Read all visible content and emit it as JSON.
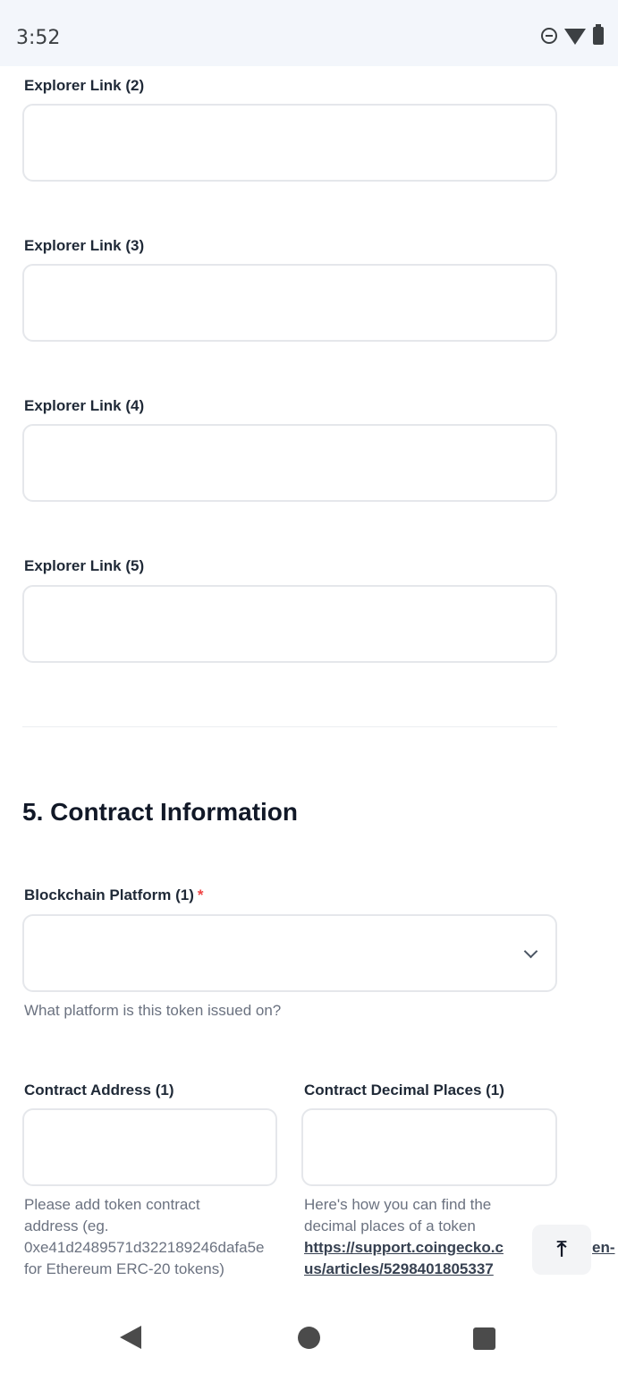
{
  "status_bar": {
    "time": "3:52",
    "icons": [
      "do-not-disturb-icon",
      "wifi-icon",
      "battery-icon"
    ]
  },
  "form": {
    "explorer_links": [
      {
        "label": "Explorer Link (2)",
        "value": ""
      },
      {
        "label": "Explorer Link (3)",
        "value": ""
      },
      {
        "label": "Explorer Link (4)",
        "value": ""
      },
      {
        "label": "Explorer Link (5)",
        "value": ""
      }
    ],
    "contract_section": {
      "title": "5. Contract Information",
      "blockchain_platform": {
        "label": "Blockchain Platform (1)",
        "required_mark": "*",
        "value": "",
        "help": "What platform is this token issued on?"
      },
      "contract_address": {
        "label": "Contract Address (1)",
        "value": "",
        "help_line1": "Please add token contract",
        "help_line2": "address (eg.",
        "help_line3": "0xe41d2489571d322189246dafa5e",
        "help_line4": "for Ethereum ERC-20 tokens)"
      },
      "contract_decimal_places": {
        "label": "Contract Decimal Places (1)",
        "value": "",
        "help_line1": "Here's how you can find the",
        "help_line2": "decimal places of a token",
        "link_line1": "https://support.coingecko.c",
        "link_line1_tail": "en-",
        "link_line2": "us/articles/5298401805337"
      }
    }
  },
  "scroll_top": {
    "icon": "arrow-up-to-top-icon",
    "glyph": "⤒"
  },
  "nav_bar": {
    "icons": [
      "back-icon",
      "home-icon",
      "recents-icon"
    ]
  }
}
